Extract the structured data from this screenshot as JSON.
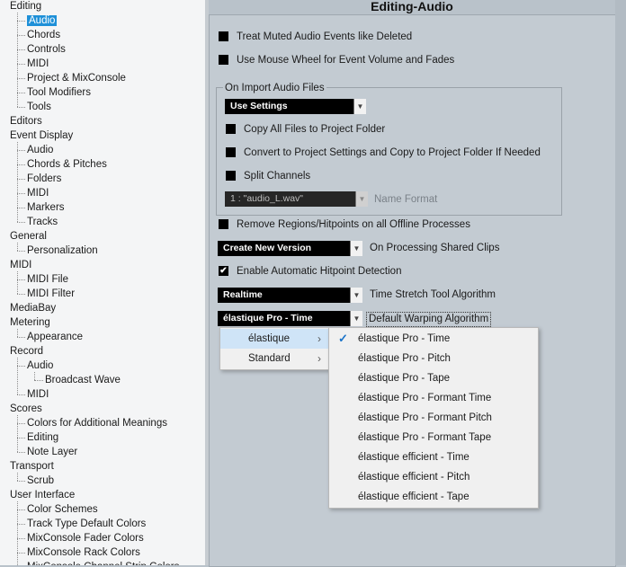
{
  "tree": [
    {
      "label": "Editing",
      "level": 0
    },
    {
      "label": "Audio",
      "level": 1,
      "selected": true
    },
    {
      "label": "Chords",
      "level": 1
    },
    {
      "label": "Controls",
      "level": 1
    },
    {
      "label": "MIDI",
      "level": 1
    },
    {
      "label": "Project & MixConsole",
      "level": 1
    },
    {
      "label": "Tool Modifiers",
      "level": 1
    },
    {
      "label": "Tools",
      "level": 1
    },
    {
      "label": "Editors",
      "level": 0
    },
    {
      "label": "Event Display",
      "level": 0
    },
    {
      "label": "Audio",
      "level": 1
    },
    {
      "label": "Chords & Pitches",
      "level": 1
    },
    {
      "label": "Folders",
      "level": 1
    },
    {
      "label": "MIDI",
      "level": 1
    },
    {
      "label": "Markers",
      "level": 1
    },
    {
      "label": "Tracks",
      "level": 1
    },
    {
      "label": "General",
      "level": 0
    },
    {
      "label": "Personalization",
      "level": 1
    },
    {
      "label": "MIDI",
      "level": 0
    },
    {
      "label": "MIDI File",
      "level": 1
    },
    {
      "label": "MIDI Filter",
      "level": 1
    },
    {
      "label": "MediaBay",
      "level": 0
    },
    {
      "label": "Metering",
      "level": 0
    },
    {
      "label": "Appearance",
      "level": 1
    },
    {
      "label": "Record",
      "level": 0
    },
    {
      "label": "Audio",
      "level": 1
    },
    {
      "label": "Broadcast Wave",
      "level": 2
    },
    {
      "label": "MIDI",
      "level": 1
    },
    {
      "label": "Scores",
      "level": 0
    },
    {
      "label": "Colors for Additional Meanings",
      "level": 1
    },
    {
      "label": "Editing",
      "level": 1
    },
    {
      "label": "Note Layer",
      "level": 1
    },
    {
      "label": "Transport",
      "level": 0
    },
    {
      "label": "Scrub",
      "level": 1
    },
    {
      "label": "User Interface",
      "level": 0
    },
    {
      "label": "Color Schemes",
      "level": 1
    },
    {
      "label": "Track Type Default Colors",
      "level": 1
    },
    {
      "label": "MixConsole Fader Colors",
      "level": 1
    },
    {
      "label": "MixConsole Rack Colors",
      "level": 1
    },
    {
      "label": "MixConsole Channel Strip Colors",
      "level": 1
    }
  ],
  "panel": {
    "title": "Editing-Audio",
    "treat_muted": "Treat Muted Audio Events like Deleted",
    "mouse_wheel": "Use Mouse Wheel for Event Volume and Fades",
    "import_group": "On Import Audio Files",
    "import_select": "Use Settings",
    "copy_all": "Copy All Files to Project Folder",
    "convert": "Convert to Project Settings and Copy to Project Folder If Needed",
    "split": "Split Channels",
    "name_format_value": "1 : \"audio_L.wav\"",
    "name_format_label": "Name Format",
    "remove_regions": "Remove Regions/Hitpoints on all Offline Processes",
    "shared_select": "Create New Version",
    "shared_label": "On Processing Shared Clips",
    "hitpoint": "Enable Automatic Hitpoint Detection",
    "stretch_select": "Realtime",
    "stretch_label": "Time Stretch Tool Algorithm",
    "warp_select": "élastique Pro - Time",
    "warp_label": "Default Warping Algorithm",
    "hitpoint_checked": true
  },
  "menu_main": [
    {
      "label": "élastique",
      "highlighted": true
    },
    {
      "label": "Standard",
      "highlighted": false
    }
  ],
  "menu_sub": [
    {
      "label": "élastique Pro - Time",
      "checked": true
    },
    {
      "label": "élastique Pro - Pitch"
    },
    {
      "label": "élastique Pro - Tape"
    },
    {
      "label": "élastique Pro - Formant Time"
    },
    {
      "label": "élastique Pro - Formant Pitch"
    },
    {
      "label": "élastique Pro - Formant Tape"
    },
    {
      "label": "élastique efficient - Time"
    },
    {
      "label": "élastique efficient - Pitch"
    },
    {
      "label": "élastique efficient - Tape"
    }
  ],
  "icons": {
    "submenu": "chevron-right-icon",
    "check": "checkmark-icon",
    "dropdown": "chevron-down-icon"
  }
}
